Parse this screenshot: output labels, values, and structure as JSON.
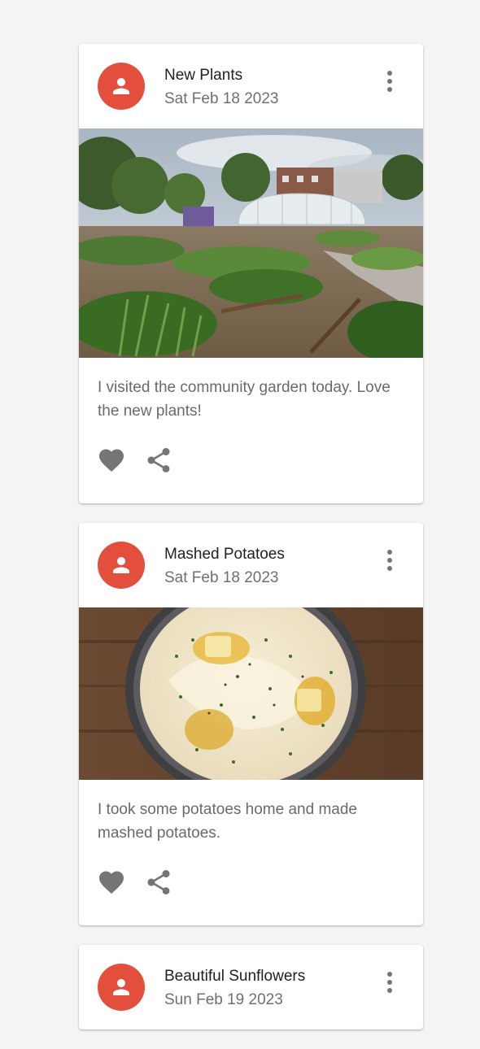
{
  "posts": [
    {
      "title": "New Plants",
      "date": "Sat Feb 18 2023",
      "body": "I visited the community garden today. Love the new plants!",
      "image": "community-garden-photo"
    },
    {
      "title": "Mashed Potatoes",
      "date": "Sat Feb 18 2023",
      "body": "I took some potatoes home and made mashed potatoes.",
      "image": "mashed-potatoes-photo"
    },
    {
      "title": "Beautiful Sunflowers",
      "date": "Sun Feb 19 2023",
      "body": "",
      "image": ""
    }
  ],
  "icons": {
    "avatar": "person-icon",
    "menu": "more-vert-icon",
    "like": "heart-icon",
    "share": "share-icon"
  },
  "colors": {
    "avatar": "#e34f3c",
    "page_background": "#f4f4f3",
    "card_background": "#ffffff",
    "icon_gray": "#757575"
  }
}
